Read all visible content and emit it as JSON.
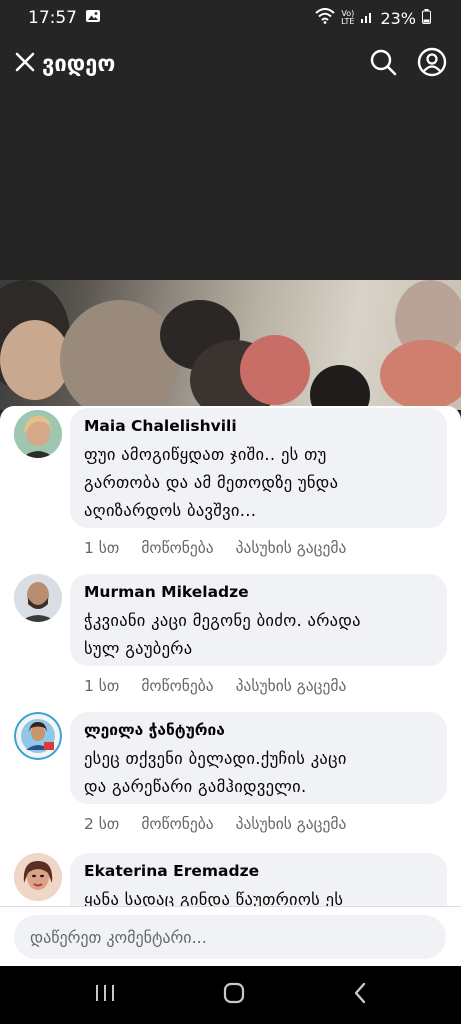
{
  "status_bar": {
    "time": "17:57",
    "network": "LTE",
    "battery": "23%"
  },
  "header": {
    "title": "ვიდეო"
  },
  "comments": [
    {
      "author": "Maia Chalelishvili",
      "text_lines": [
        "ფუი ამოგიწყდათ ჯიში.. ეს თუ",
        "გართობა და  ამ მეთოდზე უნდა",
        "აღიზარდოს ბავშვი..."
      ],
      "time": "1 სთ",
      "like": "მოწონება",
      "reply": "პასუხის გაცემა"
    },
    {
      "author": "Murman Mikeladze",
      "text_lines": [
        "ჭკვიანი კაცი მეგონე ბიძო. არადა",
        "სულ გაუბერა"
      ],
      "time": "1 სთ",
      "like": "მოწონება",
      "reply": "პასუხის გაცემა"
    },
    {
      "author": "ლეილა ჭანტურია",
      "text_lines": [
        "ესეც თქვენი ბელადი.ქუჩის კაცი",
        "და გარეწარი გამჰიდველი."
      ],
      "time": "2 სთ",
      "like": "მოწონება",
      "reply": "პასუხის გაცემა"
    },
    {
      "author": "Ekaterina Eremadze",
      "text_lines": [
        "ყანა სადაც გინდა წაუთრიოს ეს"
      ],
      "time": "",
      "like": "",
      "reply": ""
    }
  ],
  "comment_input": {
    "placeholder": "დაწერეთ კომენტარი..."
  }
}
